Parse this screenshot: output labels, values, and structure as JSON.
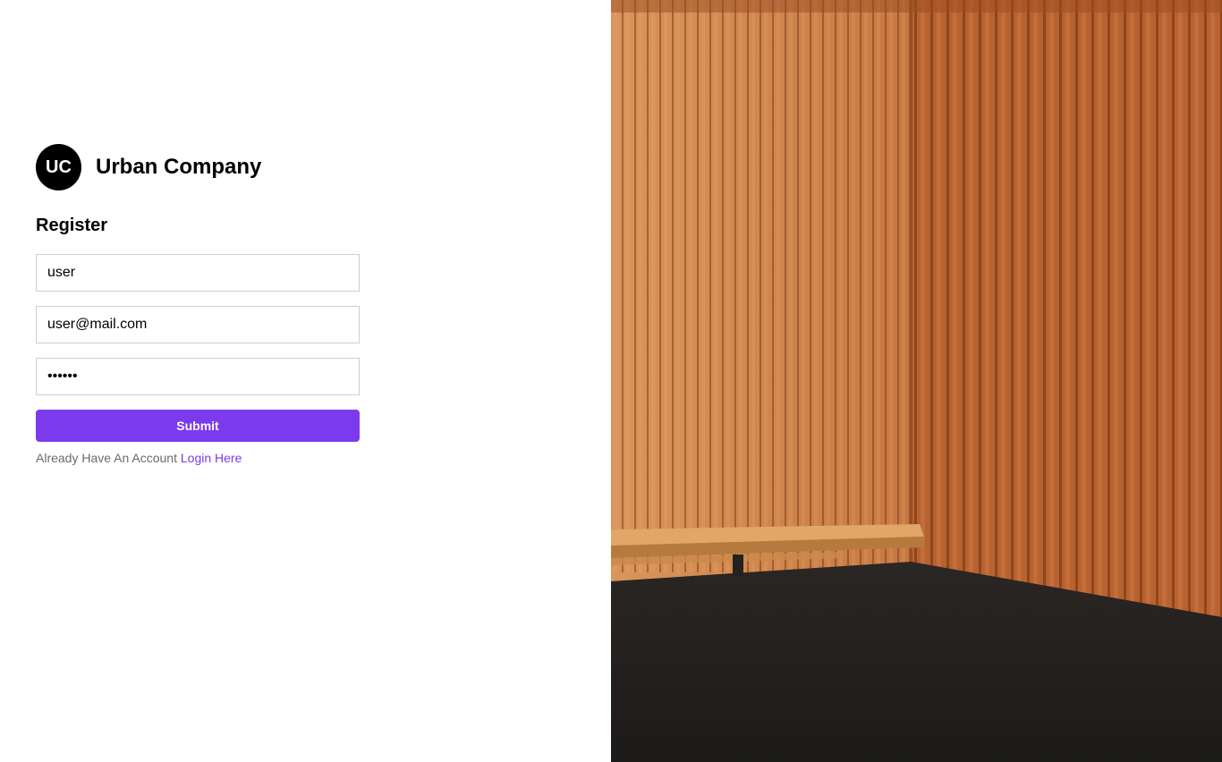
{
  "brand": {
    "logo_text": "UC",
    "name": "Urban Company"
  },
  "form": {
    "title": "Register",
    "username_value": "user",
    "email_value": "user@mail.com",
    "password_value": "••••••",
    "submit_label": "Submit",
    "account_prompt": "Already Have An Account",
    "login_link": "Login Here"
  },
  "colors": {
    "accent": "#7c3aed",
    "logo_bg": "#000000",
    "border": "#cfcfcf"
  }
}
